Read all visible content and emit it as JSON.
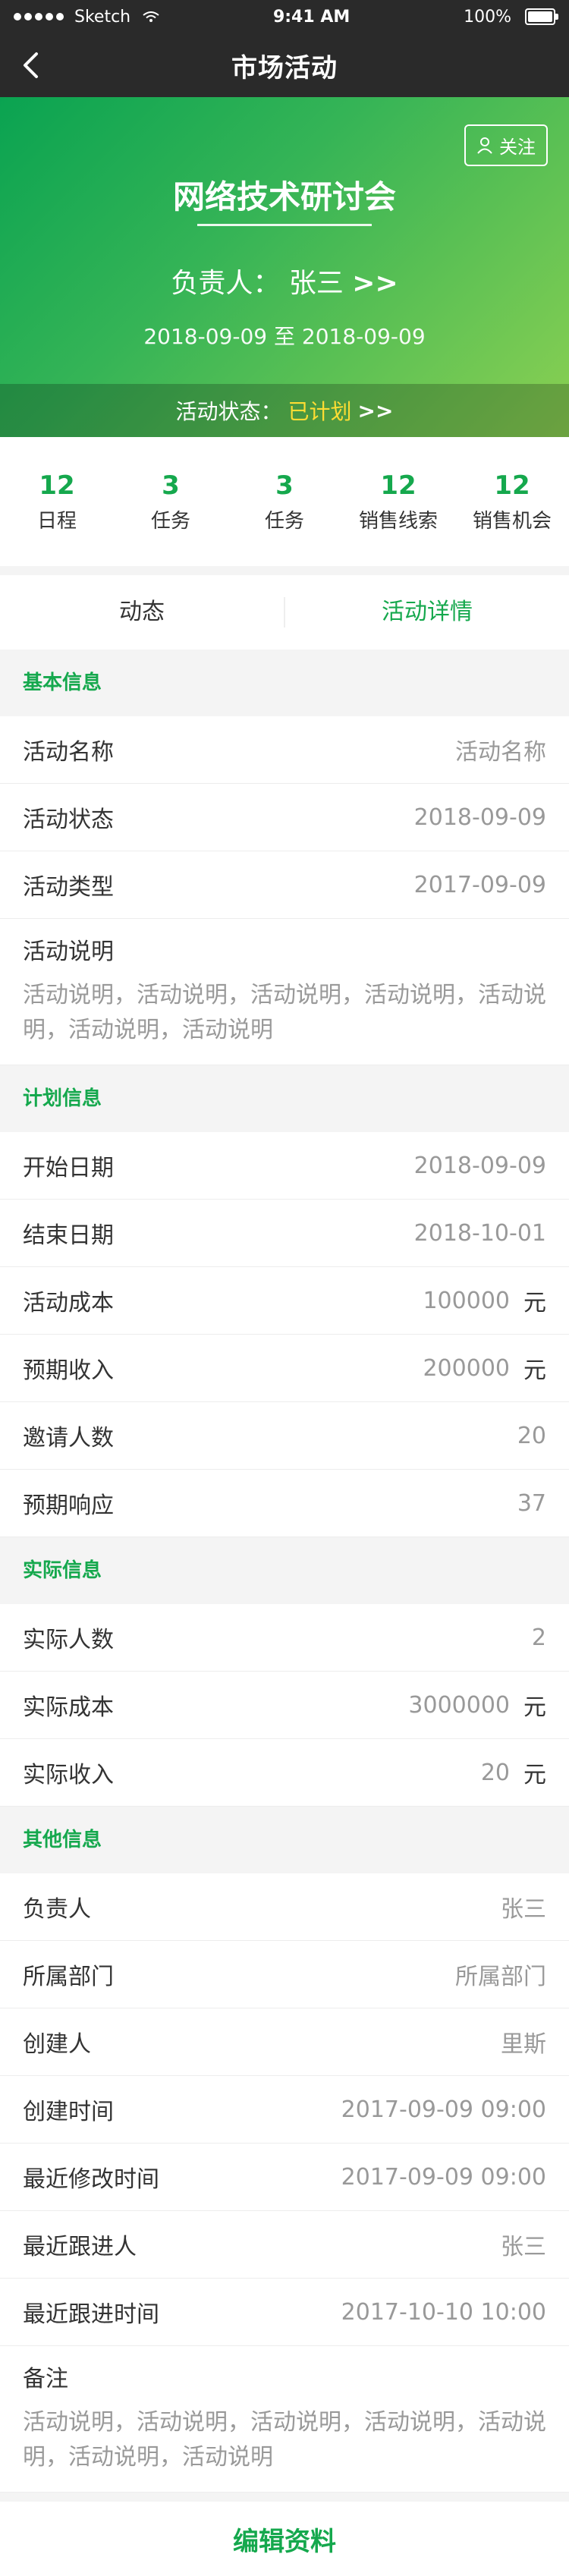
{
  "status_bar": {
    "carrier": "Sketch",
    "time": "9:41 AM",
    "battery": "100%"
  },
  "nav": {
    "title": "市场活动"
  },
  "banner": {
    "follow_label": "关注",
    "title": "网络技术研讨会",
    "owner_label": "负责人：",
    "owner_name": "张三",
    "owner_arrow": ">>",
    "date_start": "2018-09-09",
    "date_sep": "至",
    "date_end": "2018-09-09",
    "status_label": "活动状态：",
    "status_value": "已计划",
    "status_arrow": ">>"
  },
  "stats": [
    {
      "value": "12",
      "label": "日程"
    },
    {
      "value": "3",
      "label": "任务"
    },
    {
      "value": "3",
      "label": "任务"
    },
    {
      "value": "12",
      "label": "销售线索"
    },
    {
      "value": "12",
      "label": "销售机会"
    }
  ],
  "tabs": [
    {
      "label": "动态",
      "active": false
    },
    {
      "label": "活动详情",
      "active": true
    }
  ],
  "sections": [
    {
      "title": "基本信息",
      "rows": [
        {
          "label": "活动名称",
          "value": "活动名称"
        },
        {
          "label": "活动状态",
          "value": "2018-09-09"
        },
        {
          "label": "活动类型",
          "value": "2017-09-09"
        }
      ],
      "desc": {
        "label": "活动说明",
        "text": "活动说明，活动说明，活动说明，活动说明，活动说明，活动说明，活动说明"
      }
    },
    {
      "title": "计划信息",
      "rows": [
        {
          "label": "开始日期",
          "value": "2018-09-09"
        },
        {
          "label": "结束日期",
          "value": "2018-10-01"
        },
        {
          "label": "活动成本",
          "value": "100000",
          "unit": "元"
        },
        {
          "label": "预期收入",
          "value": "200000",
          "unit": "元"
        },
        {
          "label": "邀请人数",
          "value": "20"
        },
        {
          "label": "预期响应",
          "value": "37"
        }
      ]
    },
    {
      "title": "实际信息",
      "rows": [
        {
          "label": "实际人数",
          "value": "2"
        },
        {
          "label": "实际成本",
          "value": "3000000",
          "unit": "元"
        },
        {
          "label": "实际收入",
          "value": "20",
          "unit": "元"
        }
      ]
    },
    {
      "title": "其他信息",
      "rows": [
        {
          "label": "负责人",
          "value": "张三"
        },
        {
          "label": "所属部门",
          "value": "所属部门"
        },
        {
          "label": "创建人",
          "value": "里斯"
        },
        {
          "label": "创建时间",
          "value": "2017-09-09 09:00"
        },
        {
          "label": "最近修改时间",
          "value": "2017-09-09 09:00"
        },
        {
          "label": "最近跟进人",
          "value": "张三"
        },
        {
          "label": "最近跟进时间",
          "value": "2017-10-10 10:00"
        }
      ],
      "desc": {
        "label": "备注",
        "text": "活动说明，活动说明，活动说明，活动说明，活动说明，活动说明，活动说明"
      }
    }
  ],
  "footer": {
    "edit_label": "编辑资料"
  },
  "colors": {
    "accent": "#15a84d",
    "status_highlight": "#ffdd33",
    "topbar": "#2a2a2a"
  }
}
